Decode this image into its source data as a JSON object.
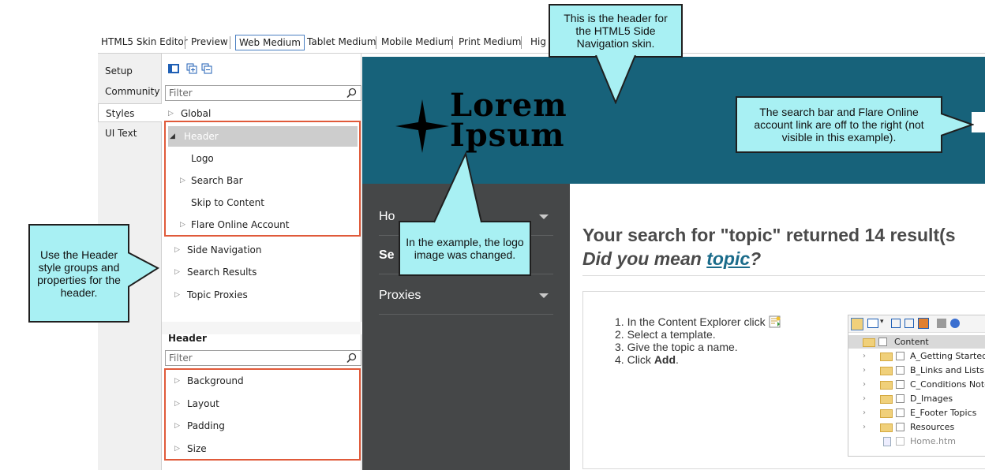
{
  "tabs": [
    "HTML5 Skin Editor",
    "Preview",
    "Web Medium",
    "Tablet Medium",
    "Mobile Medium",
    "Print Medium",
    "Hig"
  ],
  "active_tab": "Web Medium",
  "side_tabs": [
    "Setup",
    "Community",
    "Styles",
    "UI Text"
  ],
  "selected_side_tab": "Styles",
  "filter_placeholder": "Filter",
  "tree": {
    "global": "Global",
    "header": "Header",
    "logo": "Logo",
    "search_bar": "Search Bar",
    "skip_to_content": "Skip to Content",
    "flare_online_account": "Flare Online Account",
    "side_navigation": "Side Navigation",
    "search_results": "Search Results",
    "topic_proxies": "Topic Proxies"
  },
  "properties": {
    "title": "Header",
    "items": [
      "Background",
      "Layout",
      "Padding",
      "Size"
    ]
  },
  "preview": {
    "logo_line1": "Lorem",
    "logo_line2": "Ipsum",
    "nav_items": [
      "Ho",
      "Se",
      "Proxies"
    ],
    "result_title": "Your search for \"topic\" returned 14 result(s",
    "did_you_mean": "Did you mean ",
    "did_you_mean_link": "topic",
    "did_you_mean_end": "?",
    "steps": [
      {
        "pre": "In the Content Explorer click ",
        "bold": "",
        "post": ""
      },
      {
        "pre": "Select a template.",
        "bold": "",
        "post": ""
      },
      {
        "pre": "Give the topic a name.",
        "bold": "",
        "post": ""
      },
      {
        "pre": "Click ",
        "bold": "Add",
        "post": "."
      }
    ],
    "explorer": {
      "root": "Content",
      "items": [
        "A_Getting Started",
        "B_Links and Lists",
        "C_Conditions Notes",
        "D_Images",
        "E_Footer Topics",
        "Resources"
      ],
      "file": "Home.htm"
    }
  },
  "callouts": {
    "header": "This is the header for the HTML5 Side Navigation skin.",
    "search": "The search bar and Flare Online account link are off to the right (not visible in this example).",
    "logo": "In the example, the logo image was changed.",
    "styles": "Use the Header style groups and properties for the header."
  },
  "colors": {
    "header_bg": "#17627a",
    "nav_bg": "#454748",
    "callout_bg": "#a8f0f3",
    "highlight_border": "#e05a3a"
  }
}
